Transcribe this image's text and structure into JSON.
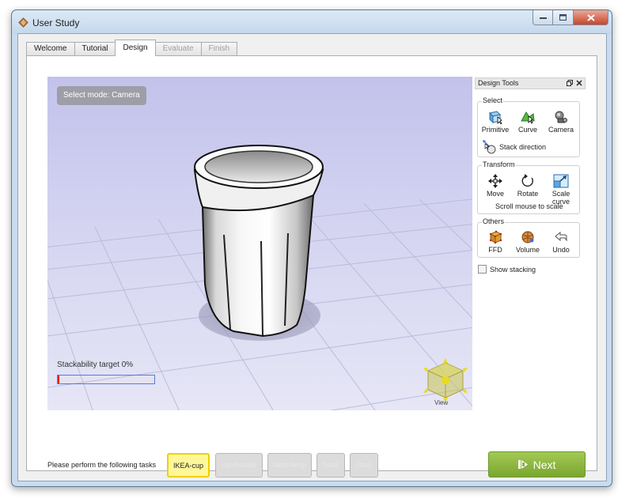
{
  "window": {
    "title": "User Study",
    "icon": "app-diamond-icon"
  },
  "tabs": [
    {
      "label": "Welcome",
      "state": "normal"
    },
    {
      "label": "Tutorial",
      "state": "normal"
    },
    {
      "label": "Design",
      "state": "active"
    },
    {
      "label": "Evaluate",
      "state": "disabled"
    },
    {
      "label": "Finish",
      "state": "disabled"
    }
  ],
  "viewport": {
    "select_mode": "Select mode: Camera",
    "stackability_label": "Stackability target 0%",
    "stackability_value": 0,
    "view_label": "View"
  },
  "design_tools": {
    "title": "Design Tools",
    "float_icon": "float-icon",
    "close_icon": "close-icon",
    "select": {
      "title": "Select",
      "primitive": "Primitive",
      "curve": "Curve",
      "camera": "Camera",
      "stack_direction": "Stack direction"
    },
    "transform": {
      "title": "Transform",
      "move": "Move",
      "rotate": "Rotate",
      "scale_curve": "Scale curve",
      "scroll_hint": "Scroll mouse to scale"
    },
    "others": {
      "title": "Others",
      "ffd": "FFD",
      "volume": "Volume",
      "undo": "Undo"
    },
    "show_stacking": "Show stacking",
    "show_stacking_checked": false
  },
  "tasks": {
    "label": "Please perform the following tasks",
    "items": [
      {
        "label": "IKEA-cup",
        "state": "active"
      },
      {
        "label": "cup-handle",
        "state": "disabled"
      },
      {
        "label": "table-lamp",
        "state": "disabled"
      },
      {
        "label": "bowl",
        "state": "disabled"
      },
      {
        "label": "chair",
        "state": "disabled"
      }
    ]
  },
  "next_button": {
    "label": "Next"
  },
  "colors": {
    "next_green": "#8ab63f",
    "active_task_yellow": "#fff79a",
    "viewport_top": "#c2c2ec",
    "viewport_bottom": "#e6e6f6"
  }
}
